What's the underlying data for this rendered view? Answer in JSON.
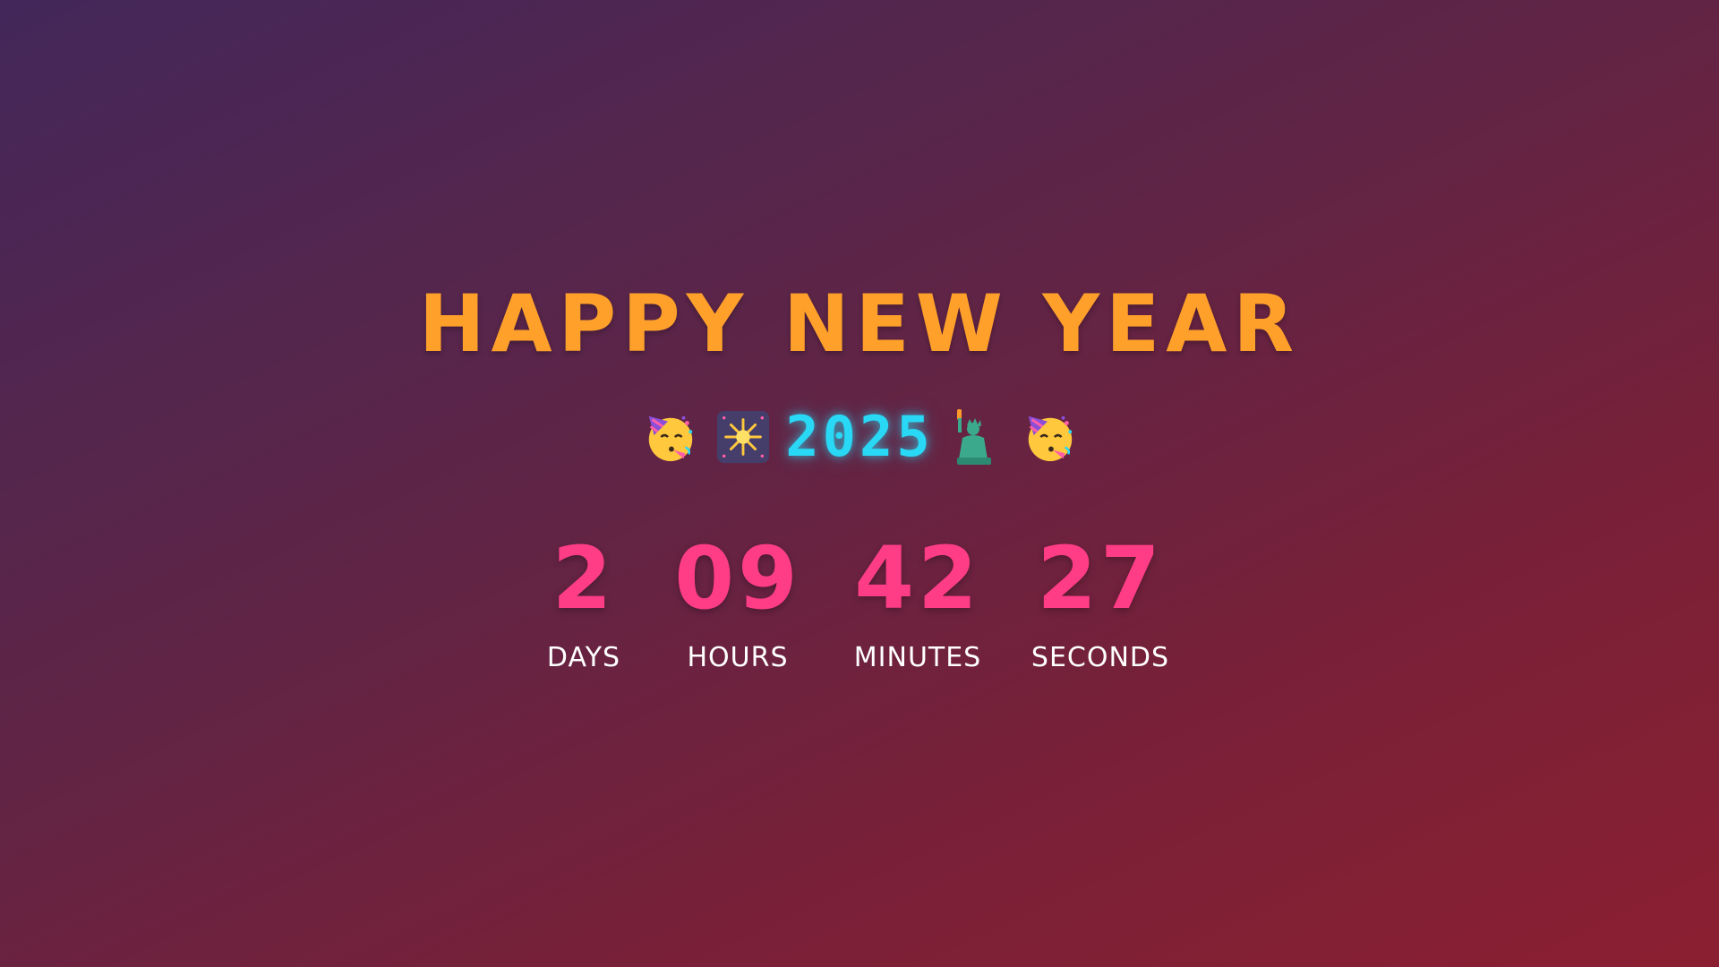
{
  "title": "HAPPY NEW YEAR",
  "year": "2025",
  "emojis": [
    "partying-face",
    "fireworks",
    "statue-of-liberty",
    "partying-face"
  ],
  "colors": {
    "title": "#ffa02b",
    "year": "#28d8f5",
    "countdown_numbers": "#ff3d86",
    "labels": "#ffffff"
  },
  "countdown": {
    "days": {
      "value": "2",
      "label": "DAYS"
    },
    "hours": {
      "value": "09",
      "label": "HOURS"
    },
    "minutes": {
      "value": "42",
      "label": "MINUTES"
    },
    "seconds": {
      "value": "27",
      "label": "SECONDS"
    }
  }
}
